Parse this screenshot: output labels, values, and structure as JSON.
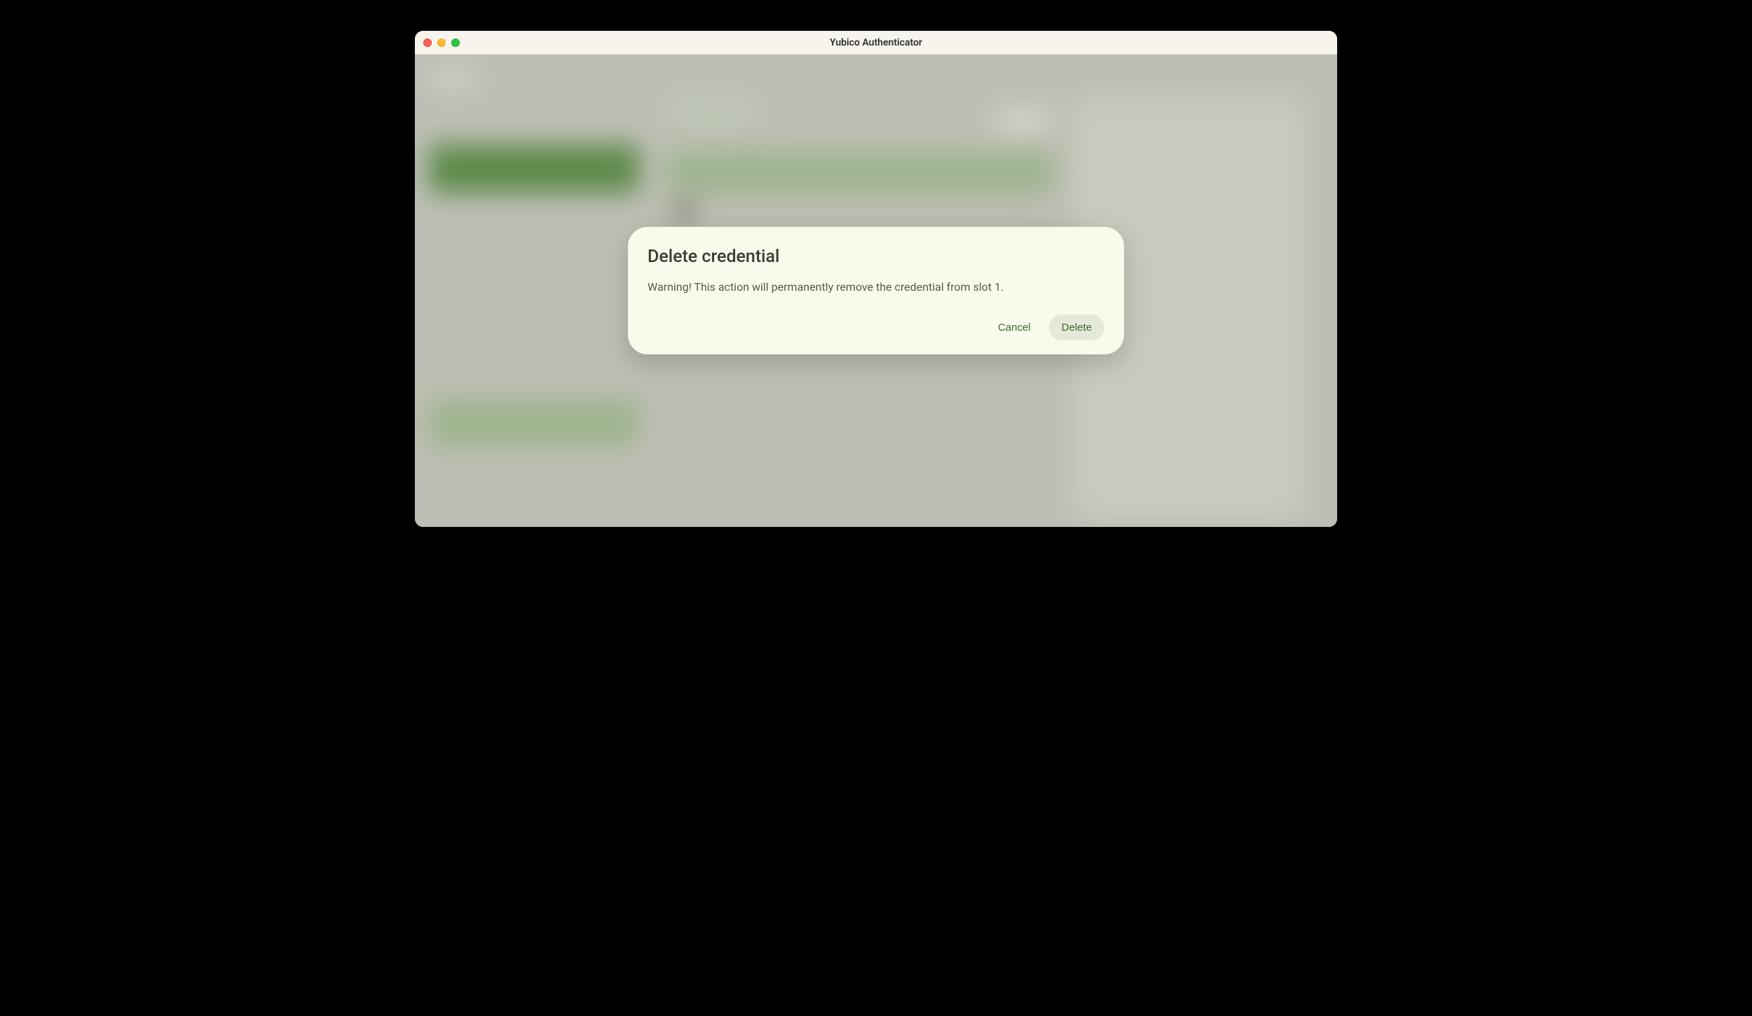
{
  "window": {
    "title": "Yubico Authenticator"
  },
  "dialog": {
    "title": "Delete credential",
    "message": "Warning! This action will permanently remove the credential from slot 1.",
    "cancel_label": "Cancel",
    "delete_label": "Delete"
  }
}
